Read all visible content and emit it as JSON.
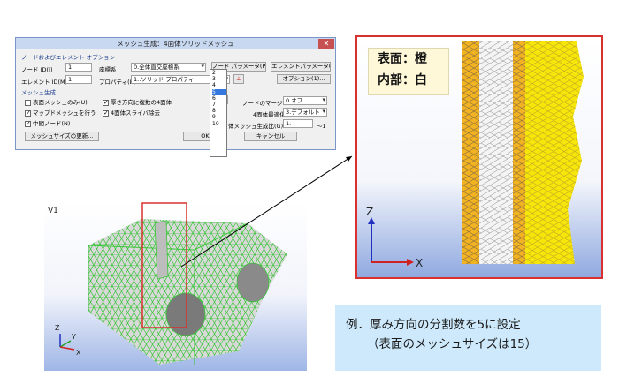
{
  "dialog": {
    "title": "メッシュ生成：4面体ソリッドメッシュ",
    "close": "✕",
    "group_node": "ノードおよびエレメント オプション",
    "node_id_label": "ノード ID(I)",
    "node_id_value": "1",
    "coord_label": "座標系",
    "coord_value": "0.全体直交座標系",
    "node_param_btn": "ノード パラメータ(P)...",
    "elem_param_btn": "エレメントパラメータ(E)...",
    "elem_id_label": "エレメント ID(M)",
    "elem_id_value": "1",
    "prop_label": "プロパティ(B)",
    "prop_value": "1..ソリッド プロパティ",
    "option_btn": "オプション(1)...",
    "group_mesh": "メッシュ生成",
    "cb_surface_only": "表面メッシュのみ(U)",
    "cb_map_mesh": "マップドメッシュを行う",
    "cb_midside": "中間ノード(N)",
    "cb_thickness": "厚さ方向に複数の4面体",
    "cb_sliver": "4面体スライバ除去",
    "thick_value": "2",
    "dropdown_items": [
      "2",
      "3",
      "4",
      "5",
      "6",
      "7",
      "8",
      "9",
      "10"
    ],
    "dropdown_selected": "5",
    "node_merge_label": "ノードのマージ",
    "node_merge_value": "0.オフ",
    "opt_label": "4面体最適化",
    "opt_value": "3.デフォルト",
    "ratio_label": "体メッシュ生成比(G)",
    "ratio_value": "1.",
    "ratio_tail": "～1",
    "mesh_size_btn": "メッシュサイズの更新...",
    "ok_btn": "OK",
    "cancel_btn": "キャンセル"
  },
  "left_view": {
    "label": "V1"
  },
  "right_view": {
    "legend_line1": "表面：橙",
    "legend_line2": "内部：白"
  },
  "axes": {
    "z": "Z",
    "x": "X",
    "y": "Y"
  },
  "example": {
    "line1": "例．厚み方向の分割数を5に設定",
    "line2": "（表面のメッシュサイズは15）"
  },
  "colors": {
    "mesh_green": "#39c539",
    "surface_orange": "#f2b322",
    "interior_white": "#ffffff",
    "highlight_red": "#d93030",
    "yellow_face": "#f7e60a"
  }
}
